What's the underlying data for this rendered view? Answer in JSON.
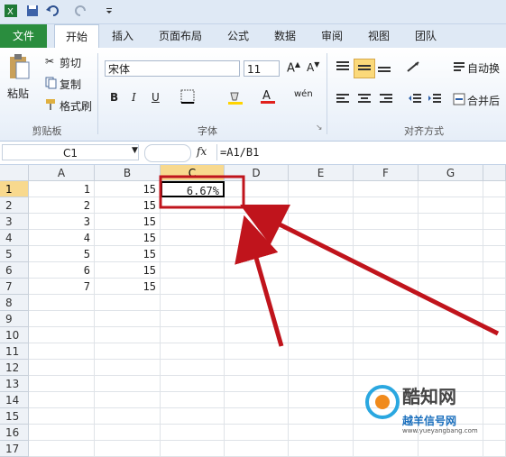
{
  "quick_access": {
    "icons": [
      "excel-icon",
      "save-icon",
      "undo-icon",
      "redo-icon",
      "customize-icon"
    ]
  },
  "tabs": [
    {
      "label": "文件"
    },
    {
      "label": "开始"
    },
    {
      "label": "插入"
    },
    {
      "label": "页面布局"
    },
    {
      "label": "公式"
    },
    {
      "label": "数据"
    },
    {
      "label": "审阅"
    },
    {
      "label": "视图"
    },
    {
      "label": "团队"
    }
  ],
  "ribbon": {
    "clipboard": {
      "paste": "粘贴",
      "cut": "剪切",
      "copy": "复制",
      "format_painter": "格式刷",
      "label": "剪贴板"
    },
    "font": {
      "name": "宋体",
      "size": "11",
      "bold": "B",
      "italic": "I",
      "underline": "U",
      "label": "字体"
    },
    "alignment": {
      "wrap": "自动换",
      "merge": "合并后",
      "label": "对齐方式"
    }
  },
  "formula_bar": {
    "name_box": "C1",
    "fx": "fx",
    "formula": "=A1/B1"
  },
  "columns": [
    "A",
    "B",
    "C",
    "D",
    "E",
    "F",
    "G"
  ],
  "rows": [
    "1",
    "2",
    "3",
    "4",
    "5",
    "6",
    "7",
    "8",
    "9",
    "10",
    "11",
    "12",
    "13",
    "14",
    "15",
    "16",
    "17"
  ],
  "cells": {
    "A": [
      "1",
      "2",
      "3",
      "4",
      "5",
      "6",
      "7"
    ],
    "B": [
      "15",
      "15",
      "15",
      "15",
      "15",
      "15",
      "15"
    ],
    "C1": "6.67%"
  },
  "watermark": {
    "text1": "酷知网",
    "text2": "越羊信号网",
    "text3": "www.yueyangbang.com"
  },
  "colors": {
    "file_tab": "#2a8d3e",
    "annotation": "#c0141c",
    "selected_header": "#f8d98e"
  }
}
